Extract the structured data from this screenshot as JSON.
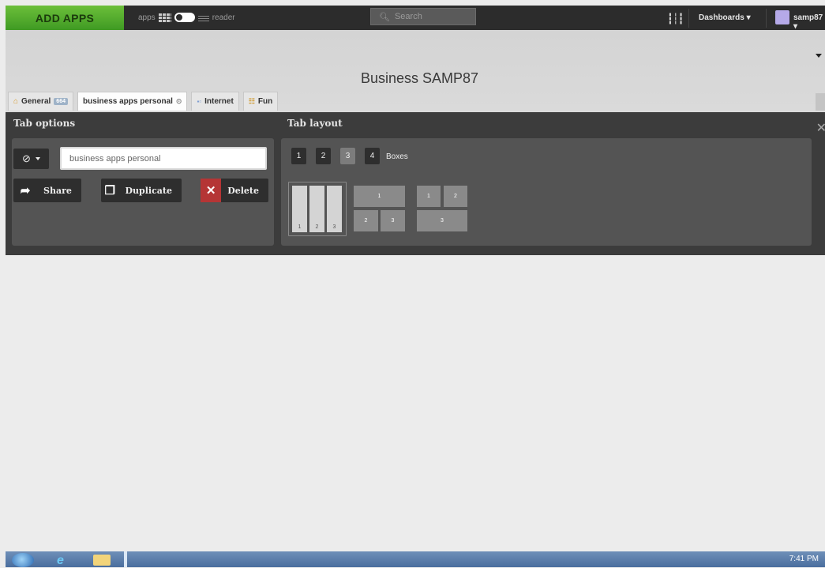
{
  "topbar": {
    "add_apps": "ADD APPS",
    "apps_label": "apps",
    "reader_label": "reader",
    "search_placeholder": "Search",
    "dashboards": "Dashboards",
    "username": "samp87"
  },
  "header": {
    "title": "Business SAMP87"
  },
  "tabs": [
    {
      "label": "General",
      "badge": "664",
      "icon": "home-icon"
    },
    {
      "label": "business apps personal",
      "icon": "settings-circle-icon"
    },
    {
      "label": "Internet",
      "icon": "internet-icon"
    },
    {
      "label": "Fun",
      "icon": "fun-icon"
    }
  ],
  "tab_options": {
    "title": "Tab options",
    "icon_symbol": "⊘",
    "name_value": "business apps personal",
    "share": "Share",
    "duplicate": "Duplicate",
    "delete": "Delete"
  },
  "tab_layout": {
    "title": "Tab layout",
    "box_counts": [
      "1",
      "2",
      "3",
      "4"
    ],
    "selected_count": "3",
    "boxes_label": "Boxes",
    "layout_a": [
      "1",
      "2",
      "3"
    ],
    "layout_b": [
      "1",
      "2",
      "3"
    ],
    "layout_c": [
      "1",
      "2",
      "3"
    ]
  },
  "taskbar": {
    "clock": "7:41 PM"
  },
  "colors": {
    "accent_green": "#4aa52a",
    "delete_red": "#b53535",
    "panel_bg": "#3c3c3c"
  }
}
